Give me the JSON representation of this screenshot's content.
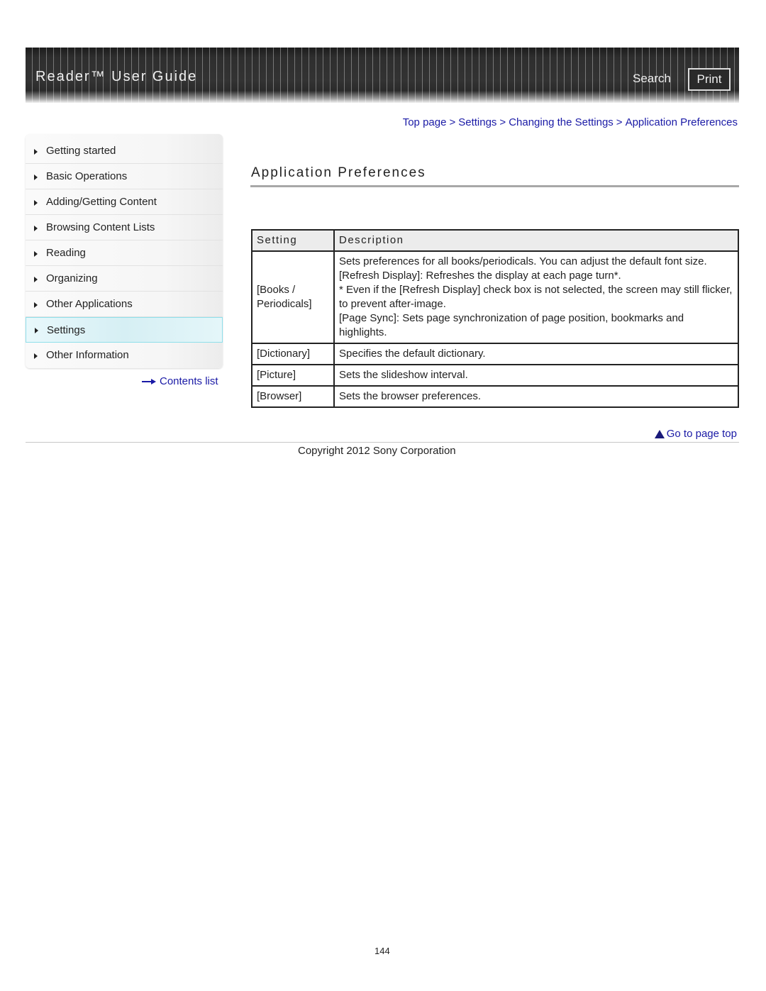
{
  "header": {
    "title": "Reader™ User Guide",
    "search_label": "Search",
    "print_label": "Print"
  },
  "sidebar": {
    "items": [
      {
        "label": "Getting started",
        "active": false
      },
      {
        "label": "Basic Operations",
        "active": false
      },
      {
        "label": "Adding/Getting Content",
        "active": false
      },
      {
        "label": "Browsing Content Lists",
        "active": false
      },
      {
        "label": "Reading",
        "active": false
      },
      {
        "label": "Organizing",
        "active": false
      },
      {
        "label": "Other Applications",
        "active": false
      },
      {
        "label": "Settings",
        "active": true
      },
      {
        "label": "Other Information",
        "active": false
      }
    ],
    "contents_list_label": "Contents list"
  },
  "breadcrumb": {
    "items": [
      "Top page",
      "Settings",
      "Changing the Settings",
      "Application Preferences"
    ],
    "separator": ">"
  },
  "main": {
    "title": "Application Preferences",
    "table": {
      "headers": [
        "Setting",
        "Description"
      ],
      "rows": [
        {
          "setting": "[Books / Periodicals]",
          "description_lines": [
            "Sets preferences for all books/periodicals. You can adjust the default font size.",
            "[Refresh Display]: Refreshes the display at each page turn*.",
            "* Even if the [Refresh Display] check box is not selected, the screen may still flicker, to prevent after-image.",
            "[Page Sync]: Sets page synchronization of page position, bookmarks and highlights."
          ]
        },
        {
          "setting": "[Dictionary]",
          "description_lines": [
            "Specifies the default dictionary."
          ]
        },
        {
          "setting": "[Picture]",
          "description_lines": [
            "Sets the slideshow interval."
          ]
        },
        {
          "setting": "[Browser]",
          "description_lines": [
            "Sets the browser preferences."
          ]
        }
      ]
    }
  },
  "footer": {
    "go_to_top_label": "Go to page top",
    "copyright": "Copyright 2012 Sony Corporation",
    "page_number": "144"
  },
  "colors": {
    "link": "#1a1aa6",
    "active_nav_border": "#8fdfea",
    "header_bg": "#333333"
  }
}
